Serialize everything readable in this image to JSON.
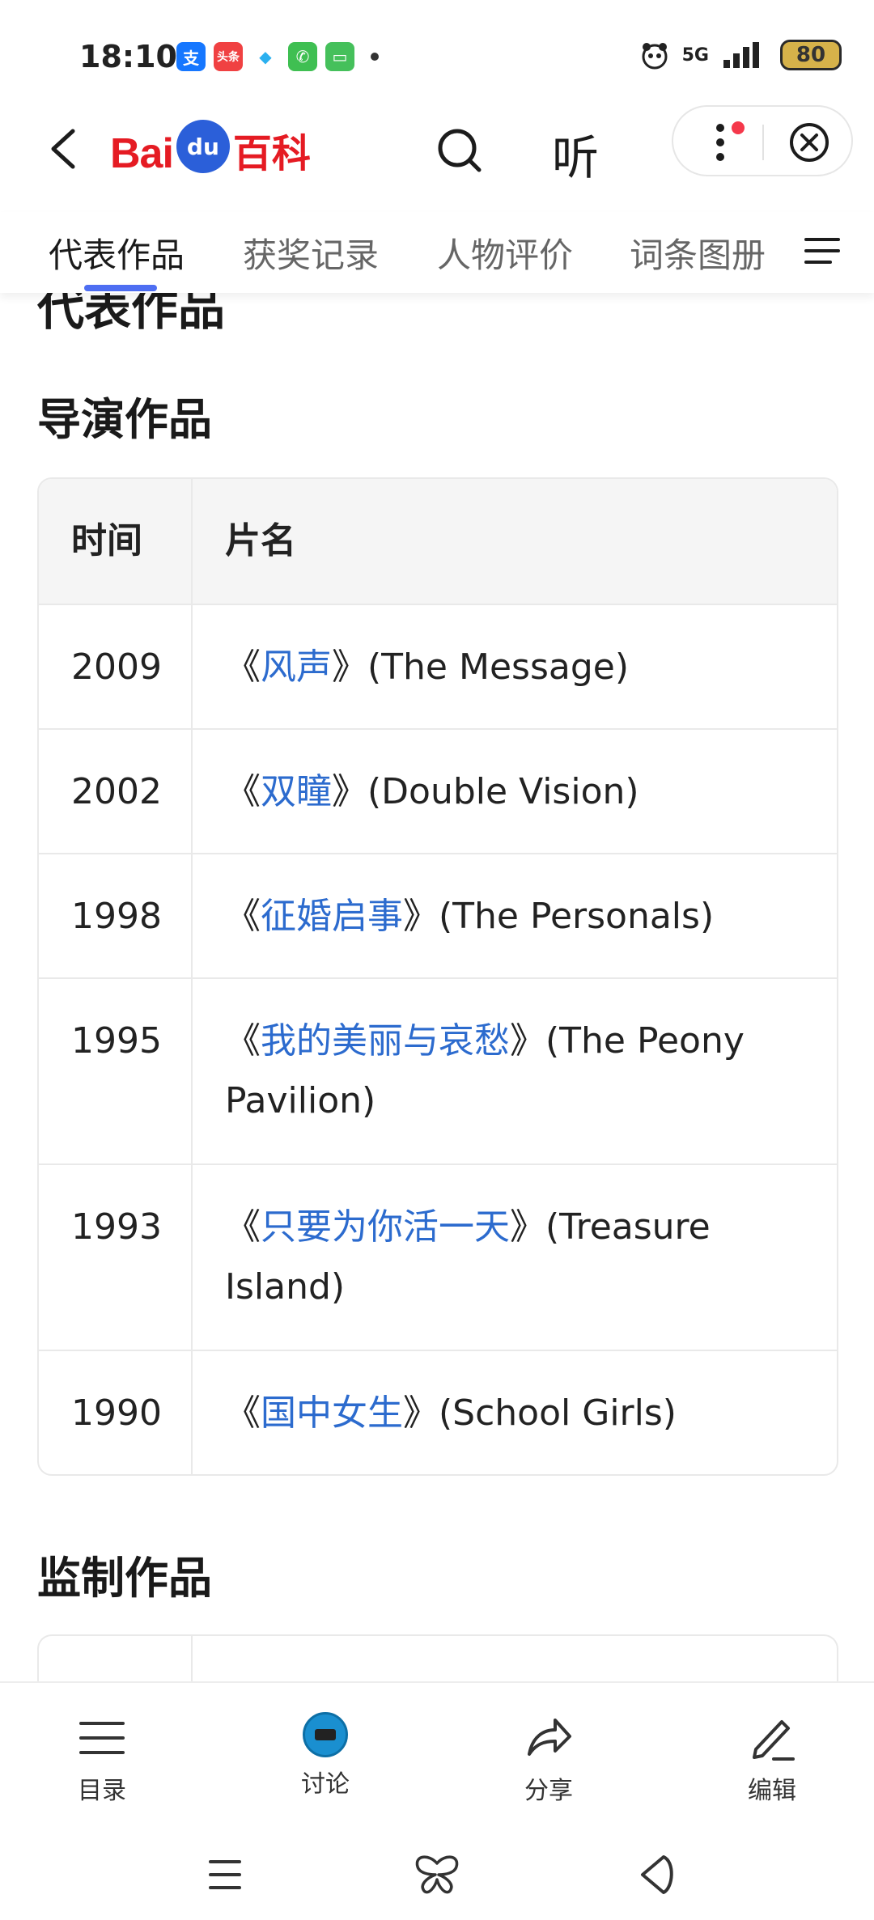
{
  "status": {
    "time": "18:10",
    "apps": [
      {
        "name": "alipay-icon",
        "glyph": "支",
        "color": "#1677ff"
      },
      {
        "name": "toutiao-icon",
        "glyph": "头条",
        "color": "#f04142"
      },
      {
        "name": "map-icon",
        "glyph": "◆",
        "color": "#2bb0ef"
      },
      {
        "name": "phone-icon",
        "glyph": "✆",
        "color": "#3fbf52"
      },
      {
        "name": "message-icon",
        "glyph": "▭",
        "color": "#45c05b"
      }
    ],
    "network": "5G",
    "battery": "80"
  },
  "header": {
    "logo_bai": "Bai",
    "logo_du": "du",
    "logo_baike": "百科",
    "listen_label": "听"
  },
  "tabs": [
    {
      "label": "代表作品",
      "active": true
    },
    {
      "label": "获奖记录",
      "active": false
    },
    {
      "label": "人物评价",
      "active": false
    },
    {
      "label": "词条图册",
      "active": false
    }
  ],
  "content": {
    "clipped_heading": "代表作品",
    "director_heading": "导演作品",
    "producer_heading": "监制作品",
    "table": {
      "headers": {
        "year": "时间",
        "title": "片名"
      },
      "rows": [
        {
          "year": "2009",
          "open": "《",
          "link": "风声",
          "close": "》",
          "english": "(The Message)"
        },
        {
          "year": "2002",
          "open": "《",
          "link": "双瞳",
          "close": "》",
          "english": "(Double Vision)"
        },
        {
          "year": "1998",
          "open": "《",
          "link": "征婚启事",
          "close": "》",
          "english": "(The Personals)"
        },
        {
          "year": "1995",
          "open": "《",
          "link": "我的美丽与哀愁",
          "close": "》",
          "english": "(The Peony Pavilion)"
        },
        {
          "year": "1993",
          "open": "《",
          "link": "只要为你活一天",
          "close": "》",
          "english": "(Treasure Island)"
        },
        {
          "year": "1990",
          "open": "《",
          "link": "国中女生",
          "close": "》",
          "english": "(School Girls)"
        }
      ]
    }
  },
  "bottom_bar": {
    "toc": "目录",
    "discuss": "讨论",
    "share": "分享",
    "edit": "编辑"
  }
}
